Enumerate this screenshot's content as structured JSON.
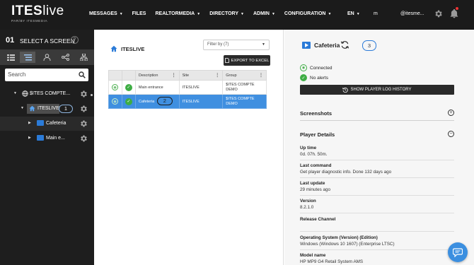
{
  "header": {
    "logo_brand": "ITES",
    "logo_live": "live",
    "logo_tagline": "PAR/BY ITESMEDIA",
    "nav": [
      {
        "label": "MESSAGES",
        "caret": true
      },
      {
        "label": "FILES",
        "caret": false
      },
      {
        "label": "REALTORMEDIA",
        "caret": true
      },
      {
        "label": "DIRECTORY",
        "caret": true
      },
      {
        "label": "ADMIN",
        "caret": true
      },
      {
        "label": "CONFIGURATION",
        "caret": true
      }
    ],
    "language": "EN",
    "user_initial": "m",
    "user_email": "@itesme..."
  },
  "left": {
    "step_number": "01",
    "step_title": "SELECT A SCREEN",
    "help_label": "?",
    "search_placeholder": "Search",
    "tree": [
      {
        "label": "$ITES COMPTE...",
        "type": "group"
      },
      {
        "label": "ITESLIVE",
        "type": "folder",
        "callout": "1"
      },
      {
        "label": "Cafeteria",
        "type": "player"
      },
      {
        "label": "Main e...",
        "type": "player"
      }
    ]
  },
  "middle": {
    "title": "ITESLIVE",
    "filter_label": "Filter by (7)",
    "export_label": "EXPORT TO EXCEL",
    "columns": [
      "Description",
      "Site",
      "Group"
    ],
    "rows": [
      {
        "description": "Main entrance",
        "site": "ITESLIVE",
        "group": "$ITES COMPTE DEMO",
        "selected": false
      },
      {
        "description": "Cafeteria",
        "site": "ITESLIVE",
        "group": "$ITES COMPTE DEMO",
        "selected": true,
        "callout": "2"
      }
    ]
  },
  "right": {
    "title": "Cafeteria",
    "callout": "3",
    "status_connected": "Connected",
    "status_alerts": "No alerts",
    "log_button": "SHOW PLAYER LOG HISTORY",
    "screenshots_title": "Screenshots",
    "details_title": "Player Details",
    "details": [
      {
        "key": "Up time",
        "value": "0d. 07h. 50m."
      },
      {
        "key": "Last command",
        "value": "Get player diagnostic info. Done 132 days ago"
      },
      {
        "key": "Last update",
        "value": "29 minutes ago"
      },
      {
        "key": "Version",
        "value": "8.2.1.0"
      },
      {
        "key": "Release Channel",
        "value": ""
      },
      {
        "key": "Operating System (Version) (Edition)",
        "value": "Windows (Windows 10 1607) (Enterprise LTSC)"
      },
      {
        "key": "Model name",
        "value": "HP MP9 G4 Retail System AMS"
      }
    ]
  },
  "colors": {
    "topbar": "#1b1b1b",
    "accent_blue": "#3f8fe0",
    "status_green": "#3ead44"
  }
}
